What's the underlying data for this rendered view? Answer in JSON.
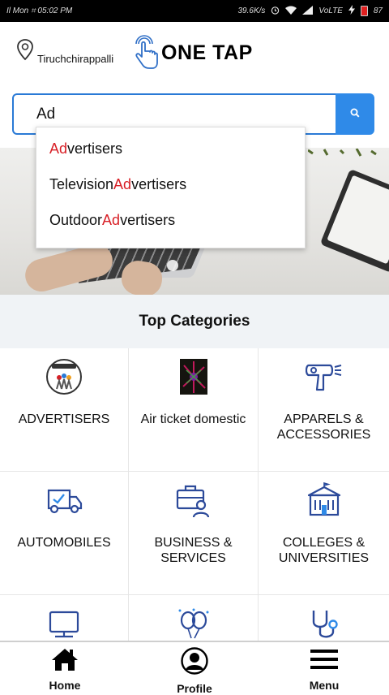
{
  "status_bar": {
    "left": "Il Mon ⌗ 05:02 PM",
    "speed": "39.6K/s",
    "network": "VoLTE",
    "battery": "87"
  },
  "header": {
    "location": "Tiruchchirappalli",
    "logo_text": "ONE TAP"
  },
  "search": {
    "value": "Ad",
    "dropdown": [
      {
        "pre": "",
        "match": "Ad",
        "post": "vertisers"
      },
      {
        "pre": "Television ",
        "match": "Ad",
        "post": "vertisers"
      },
      {
        "pre": "Outdoor ",
        "match": "Ad",
        "post": "vertisers"
      }
    ]
  },
  "categories": {
    "title": "Top Categories",
    "items": [
      {
        "label": "ADVERTISERS",
        "icon": "advertisers-logo-icon"
      },
      {
        "label": "Air ticket domestic",
        "icon": "air-ticket-image-icon"
      },
      {
        "label": "APPARELS & ACCESSORIES",
        "icon": "hair-dryer-icon"
      },
      {
        "label": "AUTOMOBILES",
        "icon": "truck-icon"
      },
      {
        "label": "BUSINESS & SERVICES",
        "icon": "briefcase-person-icon"
      },
      {
        "label": "COLLEGES & UNIVERSITIES",
        "icon": "college-building-icon"
      },
      {
        "label": "",
        "icon": "computer-icon"
      },
      {
        "label": "",
        "icon": "balloons-icon"
      },
      {
        "label": "",
        "icon": "stethoscope-icon"
      }
    ]
  },
  "bottom_nav": {
    "home": "Home",
    "profile": "Profile",
    "menu": "Menu"
  },
  "colors": {
    "accent": "#2f8ae8",
    "highlight": "#d81f26",
    "icon_blue": "#2c4a9a"
  }
}
